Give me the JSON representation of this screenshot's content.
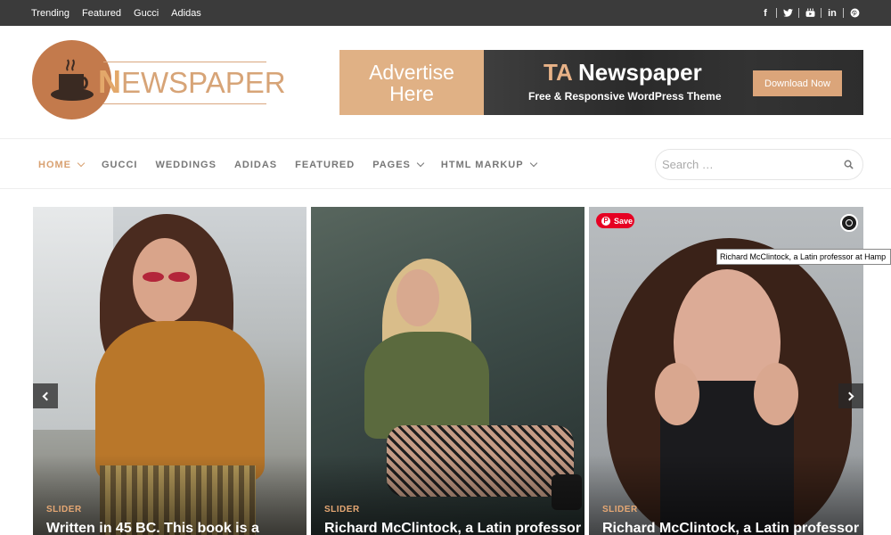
{
  "topbar": {
    "menu": [
      "Trending",
      "Featured",
      "Gucci",
      "Adidas"
    ],
    "social_icons": [
      "facebook-icon",
      "twitter-icon",
      "youtube-icon",
      "linkedin-icon",
      "pinterest-icon"
    ]
  },
  "logo": {
    "initial": "N",
    "rest": "EWSPAPER"
  },
  "ad": {
    "left_line1": "Advertise",
    "left_line2": "Here",
    "title_prefix": "TA",
    "title_rest": " Newspaper",
    "subtitle": "Free & Responsive WordPress Theme",
    "button": "Download Now"
  },
  "nav": {
    "items": [
      {
        "label": "HOME",
        "active": true,
        "has_dropdown": true
      },
      {
        "label": "GUCCI",
        "active": false,
        "has_dropdown": false
      },
      {
        "label": "WEDDINGS",
        "active": false,
        "has_dropdown": false
      },
      {
        "label": "ADIDAS",
        "active": false,
        "has_dropdown": false
      },
      {
        "label": "FEATURED",
        "active": false,
        "has_dropdown": false
      },
      {
        "label": "PAGES",
        "active": false,
        "has_dropdown": true
      },
      {
        "label": "HTML MARKUP",
        "active": false,
        "has_dropdown": true
      }
    ],
    "search_placeholder": "Search …"
  },
  "slider": {
    "slides": [
      {
        "category": "SLIDER",
        "title": "Written in 45 BC. This book is a"
      },
      {
        "category": "SLIDER",
        "title": "Richard McClintock, a Latin professor"
      },
      {
        "category": "SLIDER",
        "title": "Richard McClintock, a Latin professor"
      }
    ],
    "save_label": "Save",
    "tooltip": "Richard McClintock, a Latin professor at Hamp"
  },
  "colors": {
    "accent": "#d9a171",
    "topbar": "#3b3b3b",
    "pinterest": "#e60023"
  }
}
